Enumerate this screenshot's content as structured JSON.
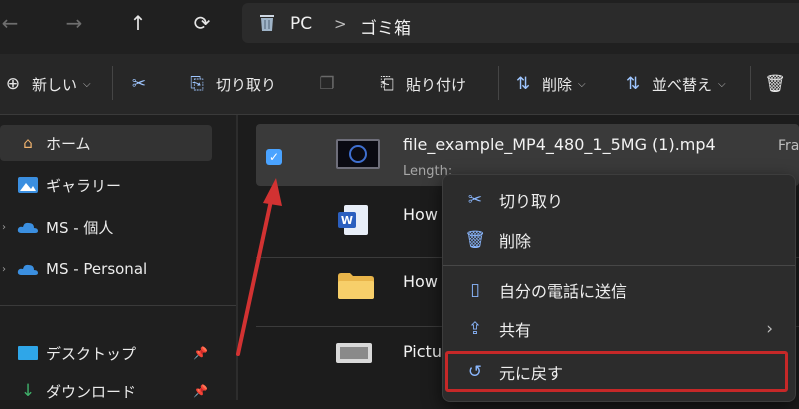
{
  "address": {
    "location": "PC",
    "separator": ">",
    "folder": "ゴミ箱"
  },
  "toolbar": {
    "new_label": "新しい",
    "cut_label": "切り取り",
    "paste_label": "貼り付け",
    "delete_label": "削除",
    "sort_label": "並べ替え"
  },
  "sidebar": {
    "items": [
      {
        "label": "ホーム",
        "icon": "home-icon"
      },
      {
        "label": "ギャラリー",
        "icon": "gallery-icon"
      },
      {
        "label": "MS - 個人",
        "icon": "cloud-icon"
      },
      {
        "label": "MS - Personal",
        "icon": "cloud-icon"
      },
      {
        "label": "デスクトップ",
        "icon": "desktop-icon"
      },
      {
        "label": "ダウンロード",
        "icon": "download-icon"
      }
    ]
  },
  "files": [
    {
      "name": "file_example_MP4_480_1_5MG (1).mp4",
      "meta": "Length:",
      "extra": "Fra",
      "icon": "video-icon"
    },
    {
      "name": "How to",
      "icon": "word-doc-icon"
    },
    {
      "name": "How to",
      "icon": "folder-icon"
    },
    {
      "name": "Picture",
      "icon": "image-icon"
    }
  ],
  "context_menu": {
    "items": [
      {
        "label": "切り取り",
        "icon": "scissors-icon"
      },
      {
        "label": "削除",
        "icon": "trash-icon"
      },
      {
        "label": "自分の電話に送信",
        "icon": "phone-icon"
      },
      {
        "label": "共有",
        "icon": "share-icon"
      },
      {
        "label": "元に戻す",
        "icon": "undo-icon"
      }
    ]
  },
  "colors": {
    "accent": "#4aa3ff",
    "highlight": "#c62828",
    "background": "#1c1c1c"
  }
}
